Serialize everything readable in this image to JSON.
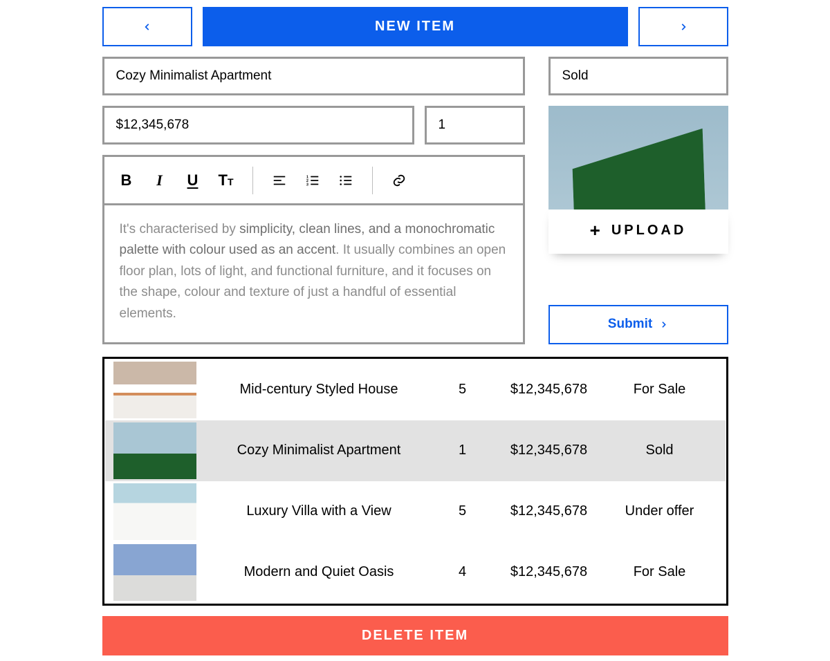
{
  "header": {
    "new_item_label": "NEW ITEM"
  },
  "form": {
    "title": "Cozy Minimalist Apartment",
    "price": "$12,345,678",
    "quantity": "1",
    "status": "Sold",
    "description_prefix": "It's characterised by ",
    "description_strong": "simplicity, clean lines, and a monochromatic palette with colour used as an accent",
    "description_suffix": ". It usually combines an open floor plan, lots of light, and functional furniture, and it focuses on the shape, colour and texture of just a handful of essential elements."
  },
  "buttons": {
    "upload": "UPLOAD",
    "submit": "Submit",
    "delete": "DELETE ITEM"
  },
  "toolbar": {
    "bold": "B",
    "italic": "I",
    "underline": "U",
    "Tbig": "T",
    "Tsmall": "T"
  },
  "listings": [
    {
      "name": "Mid-century Styled House",
      "qty": "5",
      "price": "$12,345,678",
      "status": "For Sale",
      "selected": false,
      "thumb": "t1"
    },
    {
      "name": "Cozy Minimalist Apartment",
      "qty": "1",
      "price": "$12,345,678",
      "status": "Sold",
      "selected": true,
      "thumb": "t2"
    },
    {
      "name": "Luxury Villa with a View",
      "qty": "5",
      "price": "$12,345,678",
      "status": "Under offer",
      "selected": false,
      "thumb": "t3"
    },
    {
      "name": "Modern and Quiet Oasis",
      "qty": "4",
      "price": "$12,345,678",
      "status": "For Sale",
      "selected": false,
      "thumb": "t4"
    }
  ]
}
